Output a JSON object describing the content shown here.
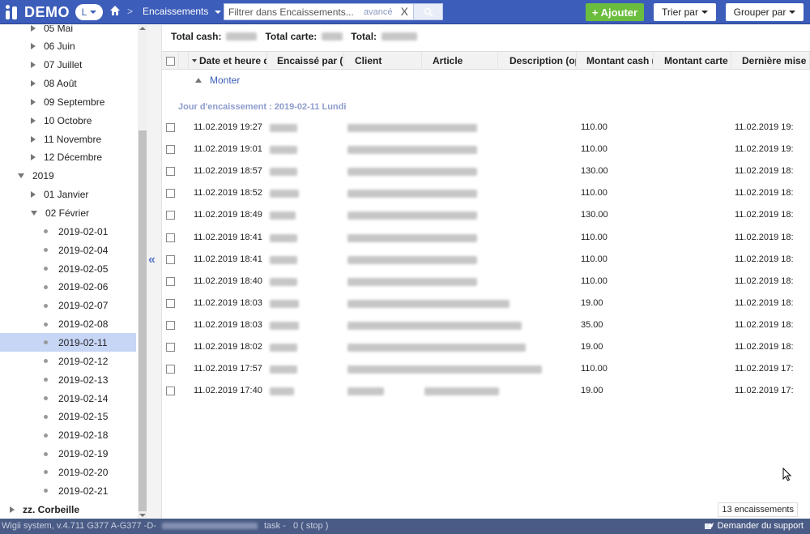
{
  "app": {
    "name": "DEMO",
    "user_initial": "L",
    "breadcrumb_sep": ">",
    "module": "Encaissements"
  },
  "search": {
    "placeholder": "Filtrer dans Encaissements...",
    "advanced": "avancé",
    "clear": "X"
  },
  "toolbar": {
    "add_label": "+ Ajouter",
    "sort_label": "Trier par",
    "group_label": "Grouper par"
  },
  "tree": {
    "items": [
      {
        "label": "05 Mai",
        "kind": "collapsed",
        "indent": 1
      },
      {
        "label": "06 Juin",
        "kind": "collapsed",
        "indent": 1
      },
      {
        "label": "07 Juillet",
        "kind": "collapsed",
        "indent": 1
      },
      {
        "label": "08 Août",
        "kind": "collapsed",
        "indent": 1
      },
      {
        "label": "09 Septembre",
        "kind": "collapsed",
        "indent": 1
      },
      {
        "label": "10 Octobre",
        "kind": "collapsed",
        "indent": 1
      },
      {
        "label": "11 Novembre",
        "kind": "collapsed",
        "indent": 1
      },
      {
        "label": "12 Décembre",
        "kind": "collapsed",
        "indent": 1
      },
      {
        "label": "2019",
        "kind": "expanded",
        "indent": 0
      },
      {
        "label": "01 Janvier",
        "kind": "collapsed",
        "indent": 1
      },
      {
        "label": "02 Février",
        "kind": "expanded",
        "indent": 1
      },
      {
        "label": "2019-02-01",
        "kind": "leaf",
        "indent": 2
      },
      {
        "label": "2019-02-04",
        "kind": "leaf",
        "indent": 2
      },
      {
        "label": "2019-02-05",
        "kind": "leaf",
        "indent": 2
      },
      {
        "label": "2019-02-06",
        "kind": "leaf",
        "indent": 2
      },
      {
        "label": "2019-02-07",
        "kind": "leaf",
        "indent": 2
      },
      {
        "label": "2019-02-08",
        "kind": "leaf",
        "indent": 2
      },
      {
        "label": "2019-02-11",
        "kind": "leaf",
        "indent": 2,
        "selected": true
      },
      {
        "label": "2019-02-12",
        "kind": "leaf",
        "indent": 2
      },
      {
        "label": "2019-02-13",
        "kind": "leaf",
        "indent": 2
      },
      {
        "label": "2019-02-14",
        "kind": "leaf",
        "indent": 2
      },
      {
        "label": "2019-02-15",
        "kind": "leaf",
        "indent": 2
      },
      {
        "label": "2019-02-18",
        "kind": "leaf",
        "indent": 2
      },
      {
        "label": "2019-02-19",
        "kind": "leaf",
        "indent": 2
      },
      {
        "label": "2019-02-20",
        "kind": "leaf",
        "indent": 2
      },
      {
        "label": "2019-02-21",
        "kind": "leaf",
        "indent": 2
      },
      {
        "label": "zz. Corbeille",
        "kind": "collapsed",
        "indent": -1,
        "bold": true
      }
    ]
  },
  "totals": {
    "cash_label": "Total cash:",
    "card_label": "Total carte:",
    "total_label": "Total:"
  },
  "table": {
    "columns": [
      "Date et heure d'",
      "Encaissé par (u",
      "Client",
      "Article",
      "Description (op",
      "Montant cash (",
      "Montant carte c",
      "Dernière mise à"
    ],
    "monter_label": "Monter",
    "group_header": "Jour d'encaissement : 2019-02-11 Lundi",
    "rows": [
      {
        "date": "11.02.2019 19:27",
        "cash": "110.00",
        "updated": "11.02.2019 19:"
      },
      {
        "date": "11.02.2019 19:01",
        "cash": "110.00",
        "updated": "11.02.2019 19:"
      },
      {
        "date": "11.02.2019 18:57",
        "cash": "130.00",
        "updated": "11.02.2019 18:"
      },
      {
        "date": "11.02.2019 18:52",
        "cash": "110.00",
        "updated": "11.02.2019 18:"
      },
      {
        "date": "11.02.2019 18:49",
        "cash": "130.00",
        "updated": "11.02.2019 18:"
      },
      {
        "date": "11.02.2019 18:41",
        "cash": "110.00",
        "updated": "11.02.2019 18:"
      },
      {
        "date": "11.02.2019 18:41",
        "cash": "110.00",
        "updated": "11.02.2019 18:"
      },
      {
        "date": "11.02.2019 18:40",
        "cash": "110.00",
        "updated": "11.02.2019 18:"
      },
      {
        "date": "11.02.2019 18:03",
        "cash": "19.00",
        "updated": "11.02.2019 18:"
      },
      {
        "date": "11.02.2019 18:03",
        "cash": "35.00",
        "updated": "11.02.2019 18:"
      },
      {
        "date": "11.02.2019 18:02",
        "cash": "19.00",
        "updated": "11.02.2019 18:"
      },
      {
        "date": "11.02.2019 17:57",
        "cash": "110.00",
        "updated": "11.02.2019 17:"
      },
      {
        "date": "11.02.2019 17:40",
        "cash": "19.00",
        "updated": "11.02.2019 17:"
      }
    ],
    "count_label": "13 encaissements"
  },
  "footer": {
    "system_prefix": "Wigii system, v.4.711 G377 A-G377 -D-",
    "task": "task -",
    "task_status": "0 ( stop )",
    "support": "Demander du support"
  },
  "colors": {
    "topbar": "#3c5db9",
    "add_button": "#6bbd3d",
    "selected_row": "#c8d6f6",
    "footer": "#4a5b85"
  }
}
